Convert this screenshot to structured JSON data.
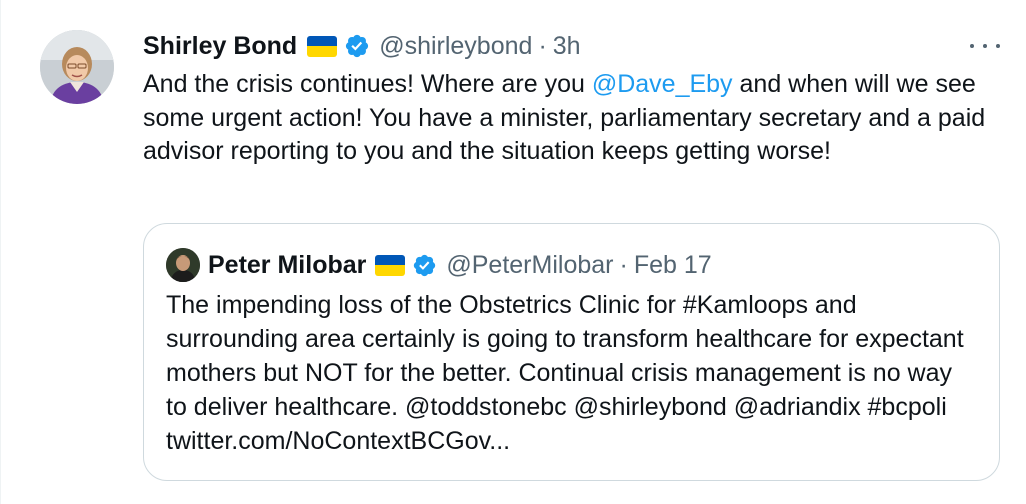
{
  "tweet": {
    "author_name": "Shirley Bond",
    "handle": "@shirleybond",
    "separator": "·",
    "time": "3h",
    "text_part1": "And the crisis continues!  Where are you ",
    "mention": "@Dave_Eby",
    "text_part2": " and when will we see some urgent action!  You have a minister, parliamentary secretary and a paid advisor reporting to you and the situation keeps getting worse!"
  },
  "quoted_tweet": {
    "author_name": "Peter Milobar",
    "handle": "@PeterMilobar",
    "separator": "·",
    "time": "Feb 17",
    "text": "The impending loss of the Obstetrics Clinic for #Kamloops and surrounding area certainly is going to transform healthcare for expectant mothers but NOT for the better. Continual crisis management is no way to deliver healthcare. @toddstonebc @shirleybond @adriandix #bcpoli twitter.com/NoContextBCGov..."
  },
  "icons": {
    "flag": "ukraine-flag-icon",
    "verified": "verified-badge-icon",
    "more": "more-options-icon"
  },
  "colors": {
    "link": "#1d9bf0",
    "secondary_text": "#536471",
    "primary_text": "#0f1419",
    "verified": "#1d9bf0",
    "flag_blue": "#0057b7",
    "flag_yellow": "#ffd700",
    "card_border": "#cfd9de"
  }
}
